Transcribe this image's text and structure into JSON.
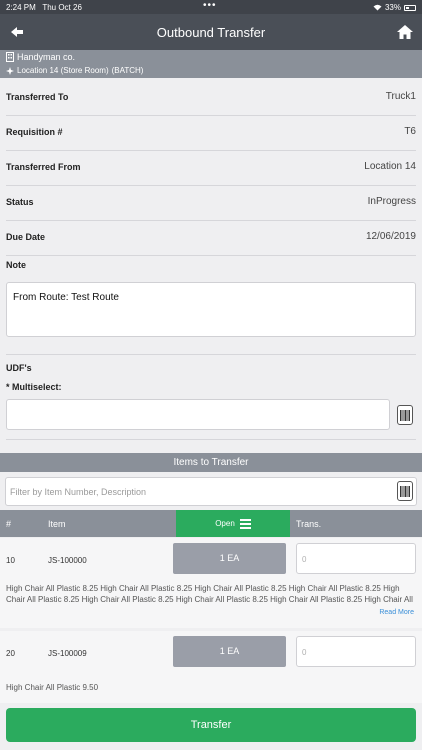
{
  "status_bar": {
    "time": "2:24 PM",
    "date": "Thu Oct 26",
    "dots": "•••",
    "battery": "33%"
  },
  "nav": {
    "title": "Outbound Transfer",
    "back_icon": "back-arrow-icon",
    "home_icon": "home-icon"
  },
  "company": {
    "name": "Handyman co.",
    "location": "Location 14 (Store Room)",
    "tag": "(BATCH)"
  },
  "fields": [
    {
      "label": "Transferred To",
      "value": "Truck1"
    },
    {
      "label": "Requisition #",
      "value": "T6"
    },
    {
      "label": "Transferred From",
      "value": "Location 14"
    },
    {
      "label": "Status",
      "value": "InProgress"
    },
    {
      "label": "Due Date",
      "value": "12/06/2019"
    }
  ],
  "note": {
    "label": "Note",
    "value": "From Route: Test Route"
  },
  "udf": {
    "label": "UDF's",
    "multiselect_label": "* Multiselect:",
    "multiselect_value": ""
  },
  "items": {
    "header": "Items to Transfer",
    "filter_placeholder": "Filter by Item Number, Description",
    "columns": {
      "num": "#",
      "item": "Item",
      "open": "Open",
      "trans": "Trans."
    },
    "rows": [
      {
        "num": "10",
        "item": "JS-100000",
        "qty": "1 EA",
        "trans_placeholder": "0",
        "description": "High Chair All Plastic 8.25 High Chair All Plastic 8.25 High Chair All Plastic 8.25 High Chair All Plastic 8.25 High Chair All Plastic 8.25 High Chair All Plastic 8.25 High Chair All Plastic 8.25 High Chair All Plastic 8.25 High Chair All Plastic 8.25 High Chair All",
        "read_more": "Read More"
      },
      {
        "num": "20",
        "item": "JS-100009",
        "qty": "1 EA",
        "trans_placeholder": "0",
        "description": "High Chair All Plastic 9.50",
        "read_more": ""
      }
    ]
  },
  "footer": {
    "button": "Transfer"
  },
  "colors": {
    "nav": "#4a4f57",
    "section": "#8a9099",
    "accent": "#2bab5e",
    "qty_chip": "#9a9ea8",
    "link": "#3a8fd8"
  }
}
